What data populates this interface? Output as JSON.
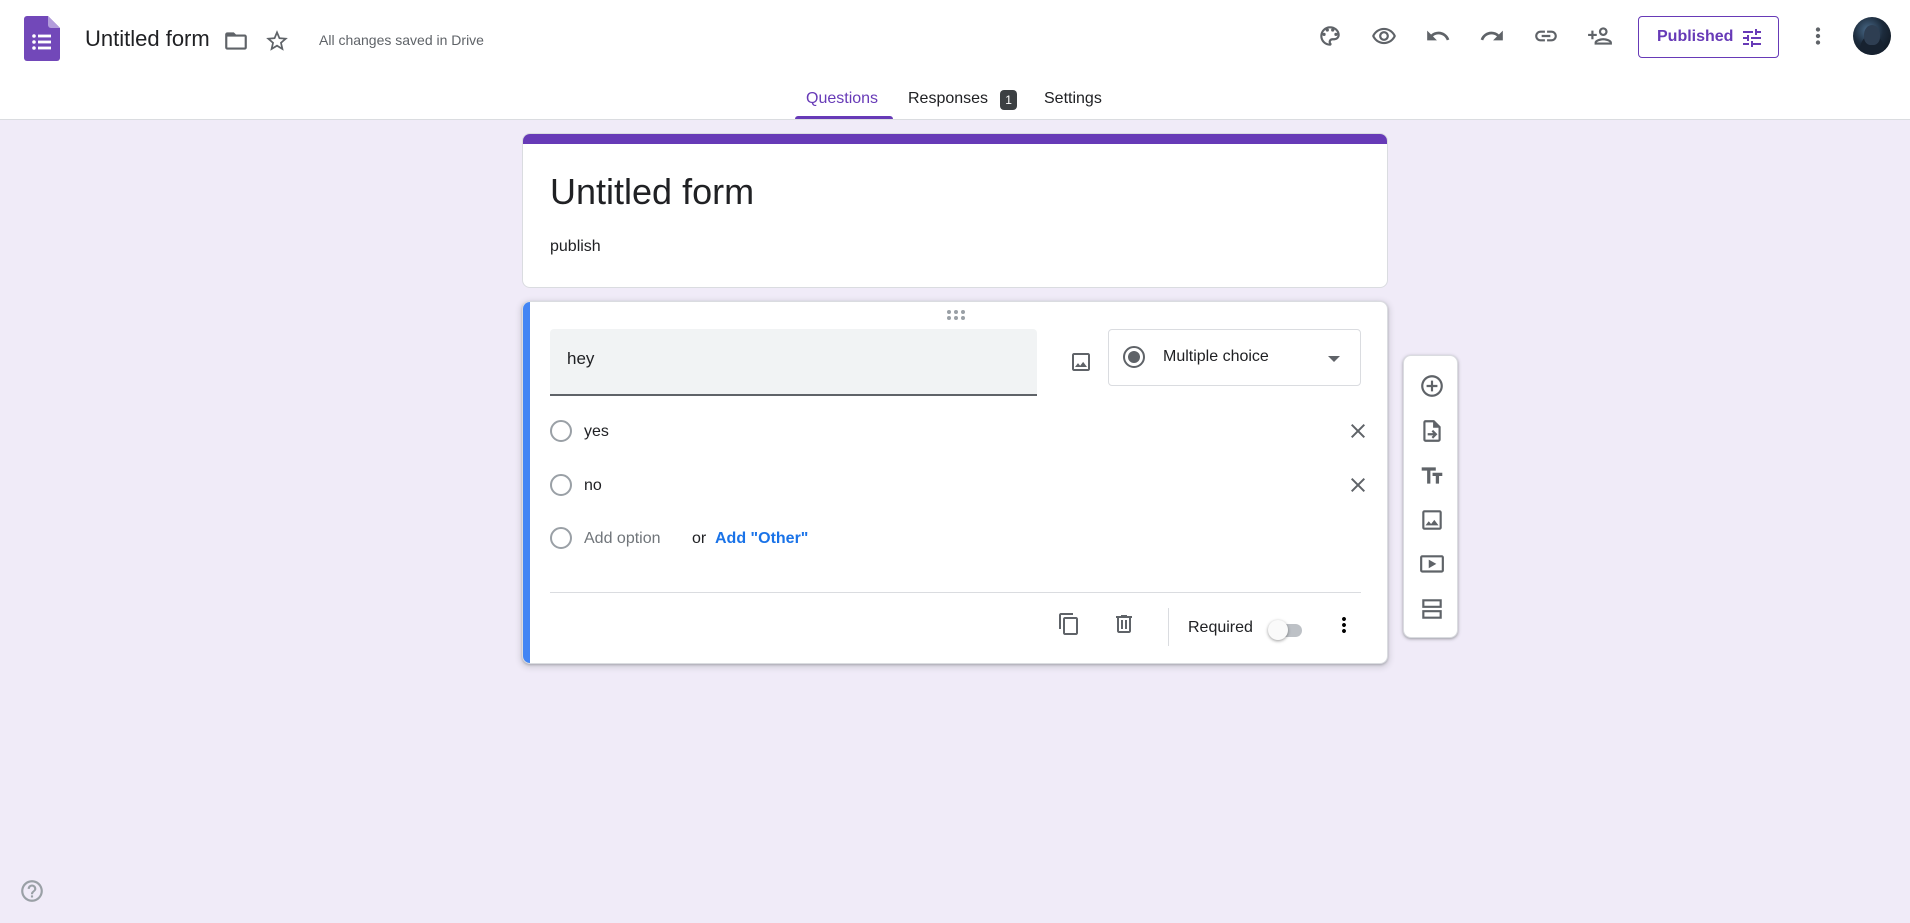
{
  "header": {
    "doc_title": "Untitled form",
    "save_status": "All changes saved in Drive",
    "published_label": "Published",
    "icons": [
      "forms-logo-icon",
      "folder-icon",
      "star-icon",
      "palette-icon",
      "eye-icon",
      "undo-icon",
      "redo-icon",
      "link-icon",
      "person-add-icon",
      "tune-icon",
      "more-vert-icon"
    ]
  },
  "tabs": [
    {
      "label": "Questions",
      "active": true
    },
    {
      "label": "Responses",
      "badge": "1"
    },
    {
      "label": "Settings"
    }
  ],
  "form": {
    "title": "Untitled form",
    "description": "publish"
  },
  "question": {
    "text": "hey",
    "type": "Multiple choice",
    "options": [
      "yes",
      "no"
    ],
    "add_option": "Add option",
    "or": "or",
    "add_other": "Add \"Other\"",
    "required_label": "Required",
    "required": false
  },
  "toolbar": {
    "tools": [
      "add-question-icon",
      "import-questions-icon",
      "add-title-icon",
      "add-image-icon",
      "add-video-icon",
      "add-section-icon"
    ]
  },
  "colors": {
    "accent": "#673ab7",
    "background": "#f0ebf8",
    "active_question_bar": "#4285f4",
    "link": "#1a73e8"
  }
}
